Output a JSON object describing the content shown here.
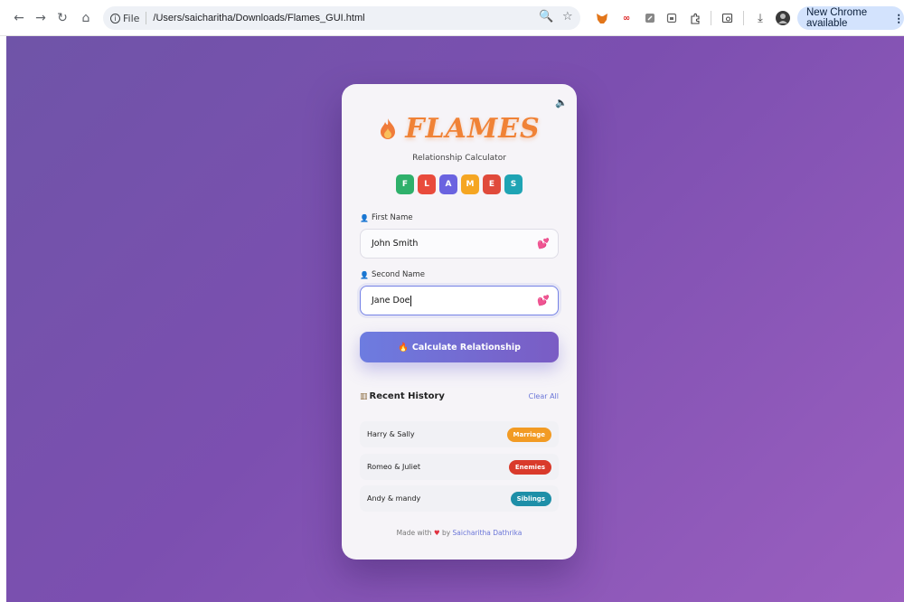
{
  "browser": {
    "file_label": "File",
    "url": "/Users/saicharitha/Downloads/Flames_GUI.html",
    "update_label": "New Chrome available"
  },
  "app": {
    "title": "FLAMES",
    "subtitle": "Relationship Calculator",
    "letters": [
      {
        "char": "F",
        "color": "#2fb06b"
      },
      {
        "char": "L",
        "color": "#e94b3c"
      },
      {
        "char": "A",
        "color": "#6a63e0"
      },
      {
        "char": "M",
        "color": "#f5a623"
      },
      {
        "char": "E",
        "color": "#e04a3b"
      },
      {
        "char": "S",
        "color": "#1fa4b4"
      }
    ],
    "first_name_label": "First Name",
    "first_name_value": "John Smith",
    "second_name_label": "Second Name",
    "second_name_value": "Jane Doe",
    "calculate_label": "Calculate Relationship",
    "history_title": "Recent History",
    "clear_all_label": "Clear All",
    "history": [
      {
        "names": "Harry & Sally",
        "result": "Marriage",
        "color": "#f29b24"
      },
      {
        "names": "Romeo & Juliet",
        "result": "Enemies",
        "color": "#d93a2b"
      },
      {
        "names": "Andy & mandy",
        "result": "Siblings",
        "color": "#1e8fa8"
      }
    ],
    "footer_prefix": "Made with",
    "footer_by": "by",
    "footer_author": "Saicharitha Dathrika"
  }
}
